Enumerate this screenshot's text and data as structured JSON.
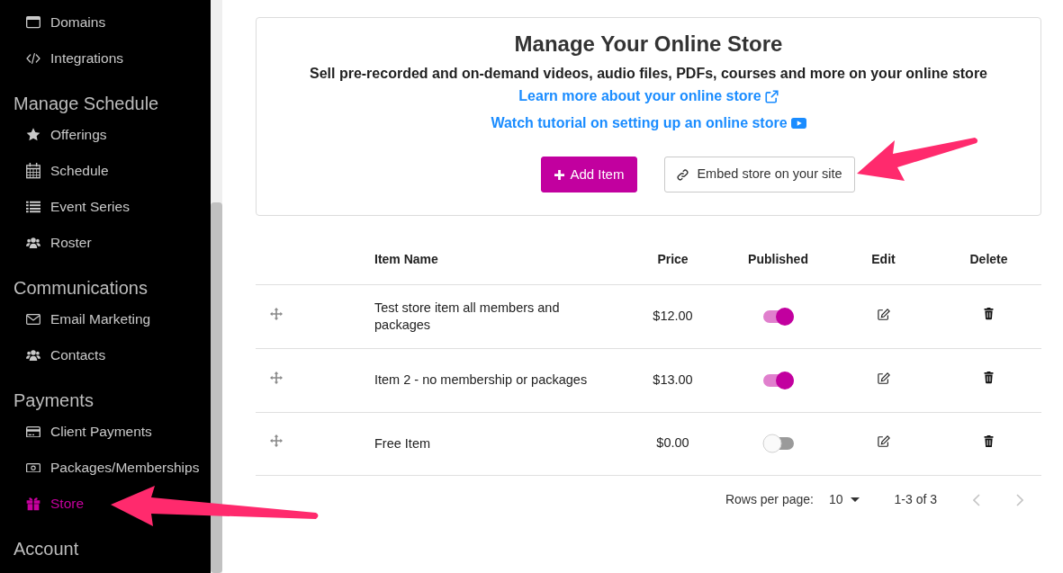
{
  "sidebar": {
    "sections": [
      {
        "items": [
          {
            "label": "Domains",
            "selected": false
          },
          {
            "label": "Integrations",
            "selected": false
          }
        ]
      },
      {
        "heading": "Manage Schedule",
        "items": [
          {
            "label": "Offerings",
            "selected": false
          },
          {
            "label": "Schedule",
            "selected": false
          },
          {
            "label": "Event Series",
            "selected": false
          },
          {
            "label": "Roster",
            "selected": false
          }
        ]
      },
      {
        "heading": "Communications",
        "items": [
          {
            "label": "Email Marketing",
            "selected": false
          },
          {
            "label": "Contacts",
            "selected": false
          }
        ]
      },
      {
        "heading": "Payments",
        "items": [
          {
            "label": "Client Payments",
            "selected": false
          },
          {
            "label": "Packages/Memberships",
            "selected": false
          },
          {
            "label": "Store",
            "selected": true
          }
        ]
      },
      {
        "heading": "Account"
      }
    ]
  },
  "store_panel": {
    "title": "Manage Your Online Store",
    "description": "Sell pre-recorded and on-demand videos, audio files, PDFs, courses and more on your online store",
    "links": [
      {
        "label": "Learn more about your online store",
        "kind": "external"
      },
      {
        "label": "Watch tutorial on setting up an online store",
        "kind": "video"
      }
    ],
    "buttons": [
      {
        "label": "Add Item",
        "kind": "primary"
      },
      {
        "label": "Embed store on your site",
        "kind": "secondary"
      }
    ]
  },
  "items_table": {
    "columns": [
      "Item Name",
      "Price",
      "Published",
      "Edit",
      "Delete"
    ],
    "rows": [
      {
        "name": "Test store item all members and packages",
        "price": "$12.00",
        "published": true
      },
      {
        "name": "Item 2 - no membership or packages",
        "price": "$13.00",
        "published": true
      },
      {
        "name": "Free Item",
        "price": "$0.00",
        "published": false
      }
    ]
  },
  "pagination": {
    "rows_per_page_label": "Rows per page:",
    "rows_per_page": "10",
    "range": "1-3 of 3",
    "previous": {
      "disabled": true
    },
    "next": {
      "disabled": true
    }
  }
}
